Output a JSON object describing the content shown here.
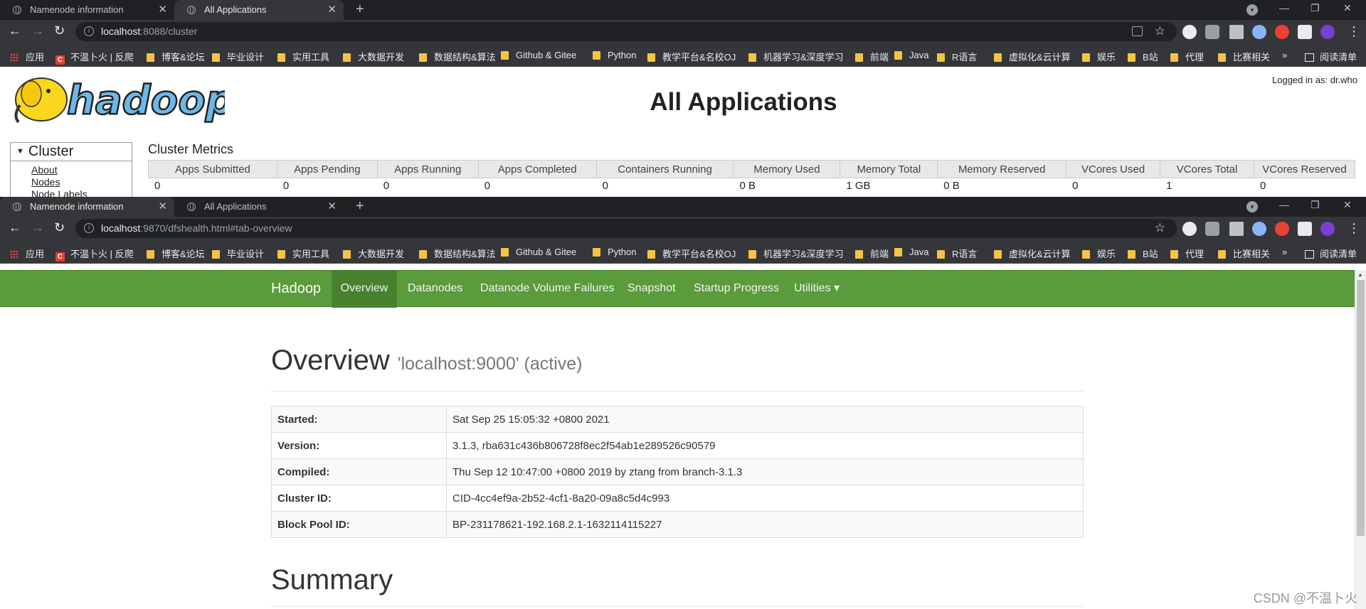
{
  "win1": {
    "tabs": [
      {
        "label": "Namenode information",
        "close": "✕"
      },
      {
        "label": "All Applications",
        "close": "✕"
      }
    ],
    "new_tab": "+",
    "controls": {
      "minimize": "—",
      "restore": "❐",
      "close": "✕"
    },
    "address": {
      "host": "localhost",
      "rest": ":8088/cluster"
    },
    "page": {
      "logo_text": "hadoop",
      "title": "All Applications",
      "logged_in": "Logged in as: dr.who",
      "cluster_header": "Cluster",
      "cluster_links": [
        "About",
        "Nodes",
        "Node Labels"
      ],
      "metrics_title": "Cluster Metrics",
      "metrics_headers": [
        "Apps Submitted",
        "Apps Pending",
        "Apps Running",
        "Apps Completed",
        "Containers Running",
        "Memory Used",
        "Memory Total",
        "Memory Reserved",
        "VCores Used",
        "VCores Total",
        "VCores Reserved"
      ],
      "metrics_values": [
        "0",
        "0",
        "0",
        "0",
        "0",
        "0 B",
        "1 GB",
        "0 B",
        "0",
        "1",
        "0"
      ]
    }
  },
  "bookmarks": [
    {
      "label": "应用",
      "icon": "apps-grid"
    },
    {
      "label": "不温卜火 | 反爬",
      "icon": "csdn-c"
    },
    {
      "label": "博客&论坛",
      "icon": "folder"
    },
    {
      "label": "毕业设计",
      "icon": "folder"
    },
    {
      "label": "实用工具",
      "icon": "folder"
    },
    {
      "label": "大数据开发",
      "icon": "folder"
    },
    {
      "label": "数据结构&算法",
      "icon": "folder"
    },
    {
      "label": "Github & Gitee",
      "icon": "folder"
    },
    {
      "label": "Python",
      "icon": "folder"
    },
    {
      "label": "教学平台&名校OJ",
      "icon": "folder"
    },
    {
      "label": "机器学习&深度学习",
      "icon": "folder"
    },
    {
      "label": "前端",
      "icon": "folder"
    },
    {
      "label": "Java",
      "icon": "folder"
    },
    {
      "label": "R语言",
      "icon": "folder"
    },
    {
      "label": "虚拟化&云计算",
      "icon": "folder"
    },
    {
      "label": "娱乐",
      "icon": "folder"
    },
    {
      "label": "B站",
      "icon": "folder"
    },
    {
      "label": "代理",
      "icon": "folder"
    },
    {
      "label": "比赛相关",
      "icon": "folder"
    }
  ],
  "bookmarks_more": "»",
  "reading_list": "阅读清单",
  "win2": {
    "tabs": [
      {
        "label": "Namenode information",
        "close": "✕"
      },
      {
        "label": "All Applications",
        "close": "✕"
      }
    ],
    "new_tab": "+",
    "controls": {
      "minimize": "—",
      "restore": "❐",
      "close": "✕"
    },
    "address": {
      "host": "localhost",
      "rest": ":9870/dfshealth.html#tab-overview"
    },
    "nav": {
      "brand": "Hadoop",
      "items": [
        "Overview",
        "Datanodes",
        "Datanode Volume Failures",
        "Snapshot",
        "Startup Progress",
        "Utilities ▾"
      ]
    },
    "overview": {
      "heading": "Overview",
      "subheading": "'localhost:9000' (active)",
      "rows": [
        {
          "key": "Started:",
          "value": "Sat Sep 25 15:05:32 +0800 2021"
        },
        {
          "key": "Version:",
          "value": "3.1.3, rba631c436b806728f8ec2f54ab1e289526c90579"
        },
        {
          "key": "Compiled:",
          "value": "Thu Sep 12 10:47:00 +0800 2019 by ztang from branch-3.1.3"
        },
        {
          "key": "Cluster ID:",
          "value": "CID-4cc4ef9a-2b52-4cf1-8a20-09a8c5d4c993"
        },
        {
          "key": "Block Pool ID:",
          "value": "BP-231178621-192.168.2.1-1632114115227"
        }
      ]
    },
    "summary_heading": "Summary",
    "watermark": "CSDN @不温卜火"
  },
  "colors": {
    "hadoop_nav_green": "#5a9b3b",
    "nav_active": "#48822f",
    "chrome_dark": "#35363a",
    "folder_yellow": "#f6c344"
  }
}
